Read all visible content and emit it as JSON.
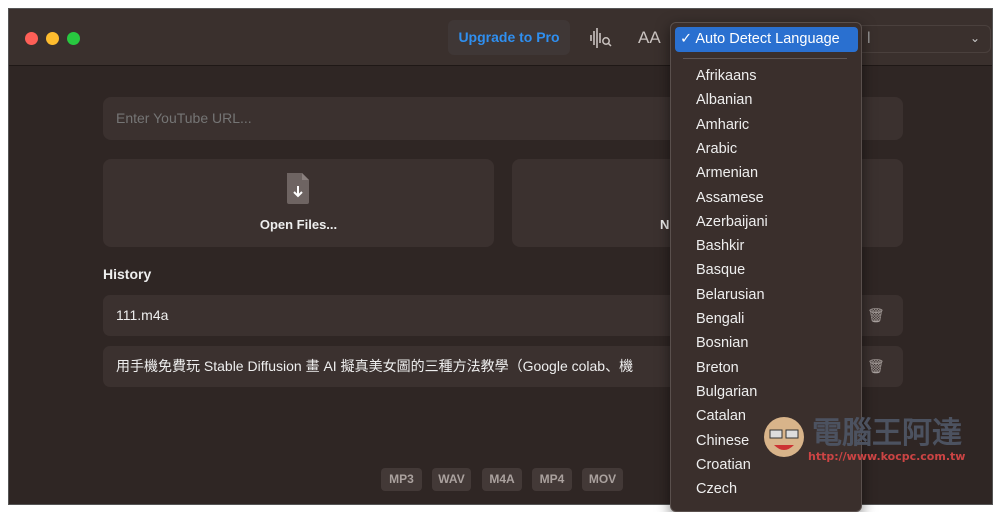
{
  "window": {
    "traffic_lights": {
      "close": "#fe5f57",
      "minimize": "#febc2e",
      "zoom": "#28c840"
    }
  },
  "toolbar": {
    "upgrade_label": "Upgrade to Pro",
    "accent": "#2f8ff0",
    "waveform_icon": "waveform-search-icon",
    "font_size_label": "AA",
    "popup_visible_fragment": "l"
  },
  "main": {
    "url_placeholder": "Enter YouTube URL...",
    "open_files_label": "Open Files...",
    "second_card_label_visible": "N",
    "history_title": "History",
    "history": [
      {
        "name": "111.m4a"
      },
      {
        "name": "用手機免費玩 Stable Diffusion 畫 AI 擬真美女圖的三種方法教學（Google colab、機"
      }
    ],
    "formats": [
      "MP3",
      "WAV",
      "M4A",
      "MP4",
      "MOV"
    ]
  },
  "language_menu": {
    "selected": "Auto Detect Language",
    "selected_color": "#2a70d0",
    "items": [
      "Afrikaans",
      "Albanian",
      "Amharic",
      "Arabic",
      "Armenian",
      "Assamese",
      "Azerbaijani",
      "Bashkir",
      "Basque",
      "Belarusian",
      "Bengali",
      "Bosnian",
      "Breton",
      "Bulgarian",
      "Catalan",
      "Chinese",
      "Croatian",
      "Czech"
    ]
  },
  "watermark": {
    "text": "電腦王阿達",
    "url": "http://www.kocpc.com.tw"
  }
}
